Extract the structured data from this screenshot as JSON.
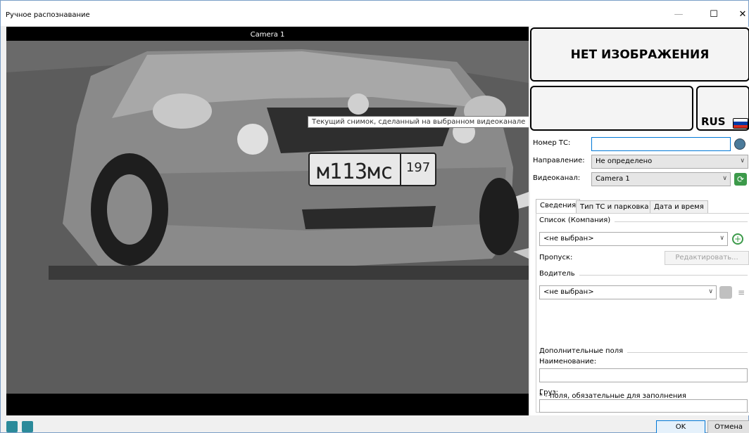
{
  "window": {
    "title": "Ручное распознавание",
    "minimize_glyph": "—",
    "maximize_glyph": "☐",
    "close_glyph": "✕"
  },
  "video": {
    "camera_label": "Camera 1",
    "tooltip": "Текущий снимок, сделанный на выбранном видеоканале",
    "plate_text": "м113мс",
    "plate_region": "197"
  },
  "recognition": {
    "no_image": "НЕТ ИЗОБРАЖЕНИЯ",
    "country": "RUS",
    "flag_colors": [
      "#ffffff",
      "#0039a6",
      "#d52b1e"
    ]
  },
  "form": {
    "plate_label": "Номер ТС:",
    "plate_value": "",
    "direction_label": "Направление:",
    "direction_value": "Не определено",
    "channel_label": "Видеоканал:",
    "channel_value": "Camera 1"
  },
  "tabs": [
    {
      "label": "Сведения",
      "active": true
    },
    {
      "label": "Тип ТС и парковка",
      "active": false
    },
    {
      "label": "Дата и время",
      "active": false
    }
  ],
  "details": {
    "list_group": "Список (Компания)",
    "list_value": "<не выбран>",
    "pass_label": "Пропуск:",
    "edit_button": "Редактировать...",
    "driver_group": "Водитель",
    "driver_value": "<не выбран>",
    "extra_group": "Дополнительные поля",
    "name_label": "Наименование:",
    "name_value": "",
    "cargo_label": "Груз:",
    "cargo_value": "",
    "required_note": "* - поля, обязательные для заполнения"
  },
  "footer": {
    "ok": "OK",
    "cancel": "Отмена"
  },
  "colors": {
    "accent": "#0078d7",
    "icon_teal": "#2b8a9a",
    "icon_green": "#3c9a4a"
  }
}
